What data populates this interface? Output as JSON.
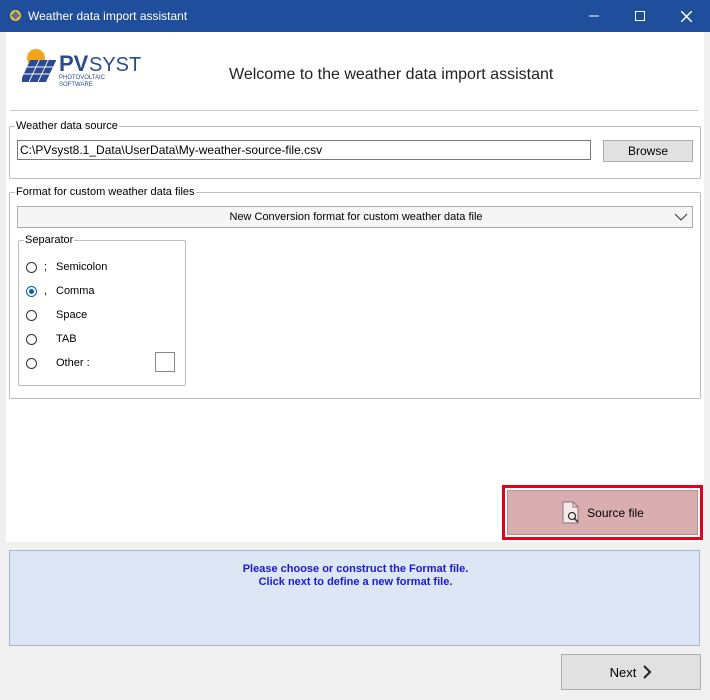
{
  "window": {
    "title": "Weather data import assistant",
    "accent": "#1f4e9c"
  },
  "header": {
    "logo_text_pv": "PV",
    "logo_text_syst": "SYST",
    "logo_sub_1": "PHOTOVOLTAIC",
    "logo_sub_2": "SOFTWARE",
    "welcome": "Welcome to the weather data import assistant"
  },
  "weather_source": {
    "legend": "Weather data source",
    "path": "C:\\PVsyst8.1_Data\\UserData\\My-weather-source-file.csv",
    "browse_label": "Browse"
  },
  "format": {
    "legend": "Format for custom weather data files",
    "selected": "New Conversion format for custom weather data file",
    "separator": {
      "legend": "Separator",
      "options": [
        {
          "symbol": ";",
          "label": "Semicolon",
          "checked": false
        },
        {
          "symbol": ",",
          "label": "Comma",
          "checked": true
        },
        {
          "symbol": "",
          "label": "Space",
          "checked": false
        },
        {
          "symbol": "",
          "label": "TAB",
          "checked": false
        },
        {
          "symbol": "",
          "label": "Other :",
          "checked": false
        }
      ]
    }
  },
  "source_file_label": "Source file",
  "highlight_color": "#e2001a",
  "info": {
    "line1": "Please choose or construct the Format file.",
    "line2": "Click next to define a new format file."
  },
  "next_label": "Next",
  "icons": [
    "app-icon",
    "minimize-icon",
    "maximize-icon",
    "close-icon",
    "chevron-down-icon",
    "document-search-icon",
    "arrow-right-icon"
  ]
}
